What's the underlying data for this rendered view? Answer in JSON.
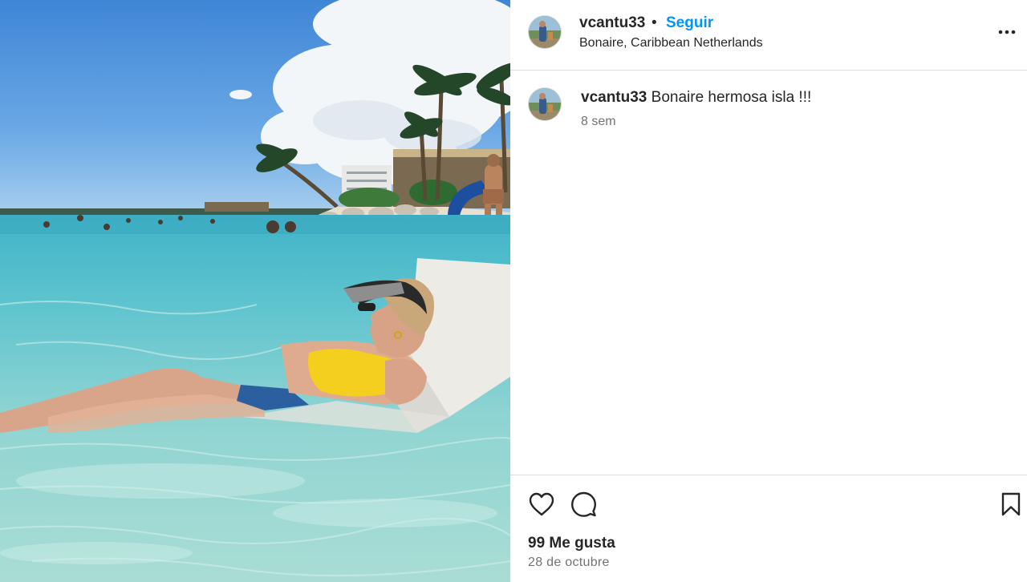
{
  "post": {
    "username": "vcantu33",
    "separator": "•",
    "follow_label": "Seguir",
    "location": "Bonaire, Caribbean Netherlands"
  },
  "caption": {
    "username": "vcantu33",
    "text": "Bonaire hermosa isla !!!",
    "time_ago": "8 sem"
  },
  "stats": {
    "likes_label": "99 Me gusta",
    "date": "28 de octubre"
  },
  "icons": {
    "more": "more-horizontal-icon",
    "like": "heart-icon",
    "comment": "comment-bubble-icon",
    "save": "bookmark-icon"
  },
  "colors": {
    "accent": "#0095f6",
    "text": "#262626",
    "secondary_text": "#737373",
    "divider": "#dbdbdb"
  }
}
